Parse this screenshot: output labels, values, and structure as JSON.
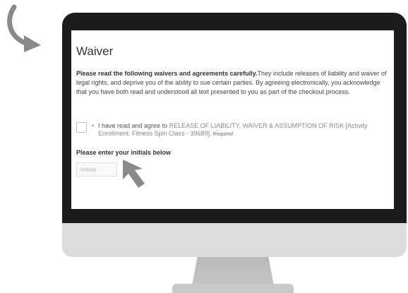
{
  "waiver": {
    "title": "Waiver",
    "intro_bold": "Please read the following waivers and agreements carefully.",
    "intro_rest": "They include releases of liability and waiver of legal rights, and deprive you of the ability to sue certain parties. By agreeing electronically, you acknowledge that you have both read and understood all text presented to you as part of the checkout process.",
    "agreement": {
      "bullet": "•",
      "prefix": "I have read and agree to ",
      "document": "RELEASE OF LIABILITY, WAIVER & ASSUMPTION OF RISK [Activity Enrollment: Fitness Spin Class - 39689].",
      "required": " Required",
      "checked": false
    },
    "initials_label": "Please enter your initials below",
    "initials_placeholder": "Initials",
    "initials_value": ""
  },
  "decor": {
    "curved_arrow_icon": "curved-arrow-icon",
    "mouse_pointer_icon": "mouse-pointer-icon",
    "arrow_color": "#8a8a8a",
    "monitor_color": "#1c1c1c",
    "chin_color": "#dcdcdc"
  }
}
